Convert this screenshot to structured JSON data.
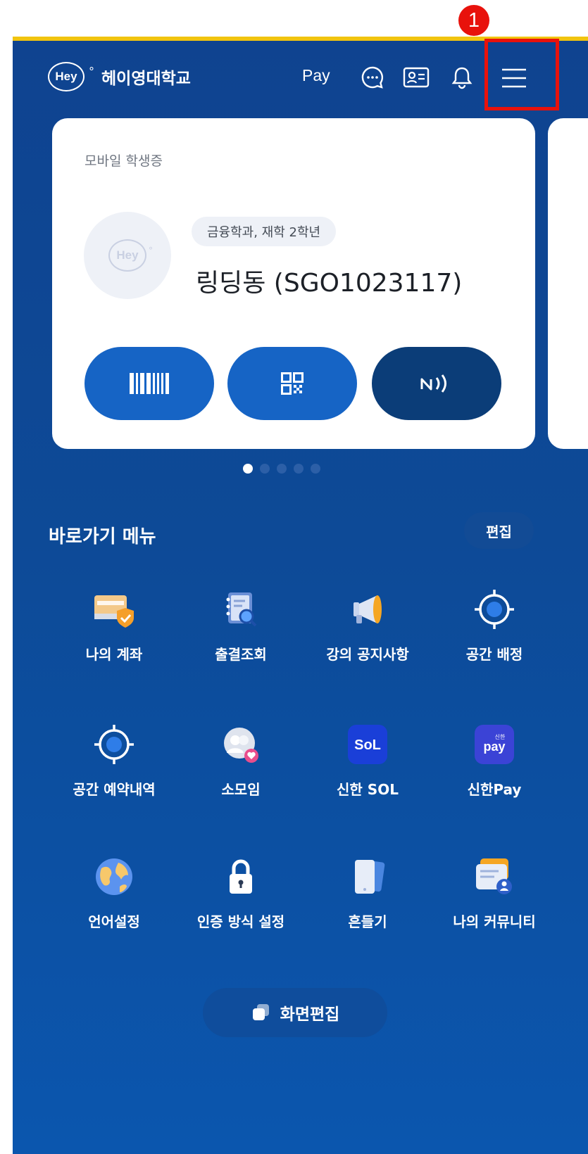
{
  "annotation": {
    "step_number": "1",
    "highlight_color": "#e8120c"
  },
  "header": {
    "logo_text": "Hey",
    "logo_mark": "°",
    "university_name": "헤이영대학교",
    "pay_label": "Pay",
    "icons": [
      "chat-icon",
      "id-card-icon",
      "bell-icon",
      "hamburger-menu-icon"
    ]
  },
  "student_card": {
    "title": "모바일 학생증",
    "avatar_text": "Hey",
    "avatar_mark": "°",
    "department": "금융학과, 재학 2학년",
    "name_id": "링딩동 (SGO1023117)",
    "buttons": [
      "barcode-icon",
      "qr-code-icon",
      "nfc-icon"
    ]
  },
  "carousel": {
    "total": 5,
    "active_index": 0
  },
  "quick_menu": {
    "title": "바로가기 메뉴",
    "edit_label": "편집",
    "items": [
      {
        "label": "나의 계좌",
        "icon": "account-icon"
      },
      {
        "label": "출결조회",
        "icon": "attendance-icon"
      },
      {
        "label": "강의 공지사항",
        "icon": "megaphone-icon"
      },
      {
        "label": "공간 배정",
        "icon": "target-icon"
      },
      {
        "label": "공간 예약내역",
        "icon": "target-icon"
      },
      {
        "label": "소모임",
        "icon": "group-icon"
      },
      {
        "label": "신한 SOL",
        "icon": "sol-icon",
        "icon_text": "SoL"
      },
      {
        "label": "신한Pay",
        "icon": "shinhan-pay-icon",
        "icon_text": "pay",
        "icon_small": "신한"
      },
      {
        "label": "언어설정",
        "icon": "globe-icon"
      },
      {
        "label": "인증 방식 설정",
        "icon": "lock-icon"
      },
      {
        "label": "흔들기",
        "icon": "phone-icon"
      },
      {
        "label": "나의 커뮤니티",
        "icon": "community-icon"
      }
    ]
  },
  "screen_edit_label": "화면편집",
  "colors": {
    "primary": "#0f4390",
    "accent_blue": "#1664c5",
    "dark_navy": "#0b3d78",
    "gold": "#f1c40f"
  }
}
